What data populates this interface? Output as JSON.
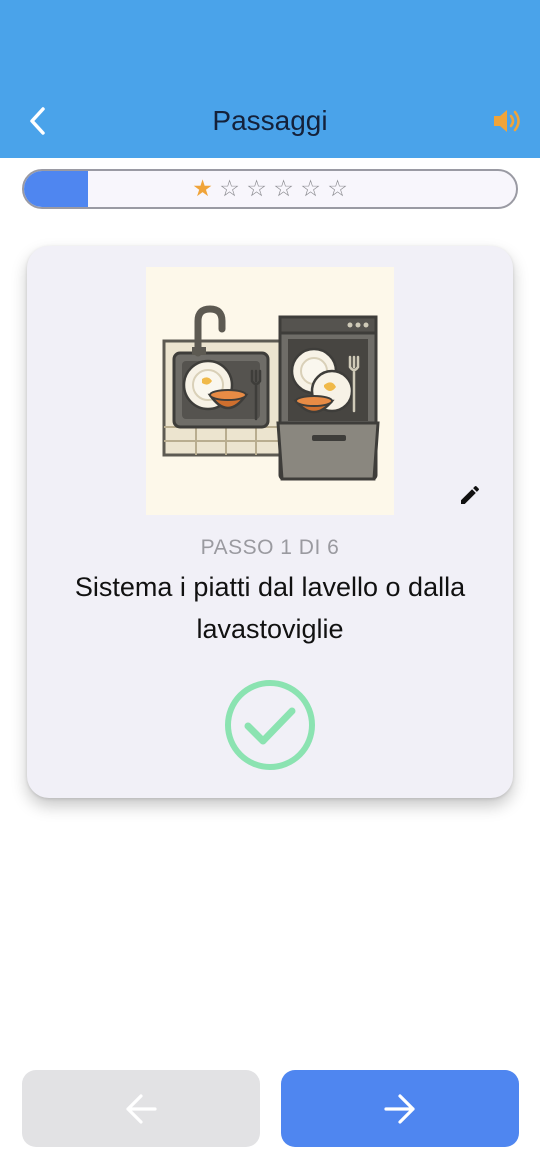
{
  "header": {
    "title": "Passaggi",
    "back_icon": "chevron-left-icon",
    "sound_icon": "speaker-icon",
    "background_color": "#4aa3ea",
    "sound_color": "#f0a43a"
  },
  "progress": {
    "fraction": 0.13,
    "stars_filled": 1,
    "stars_total": 6,
    "fill_color": "#4f86f0",
    "star_color": "#f0a43a"
  },
  "card": {
    "illustration": "sink-and-dishwasher-illustration",
    "edit_icon": "pencil-icon",
    "step_label": "PASSO 1 DI 6",
    "step_text": "Sistema i piatti dal lavello o dalla lavastoviglie",
    "done_icon": "check-circle-icon",
    "done_color": "#8be3b1"
  },
  "navigation": {
    "prev_icon": "arrow-left-icon",
    "next_icon": "arrow-right-icon",
    "prev_enabled": false,
    "next_enabled": true
  }
}
